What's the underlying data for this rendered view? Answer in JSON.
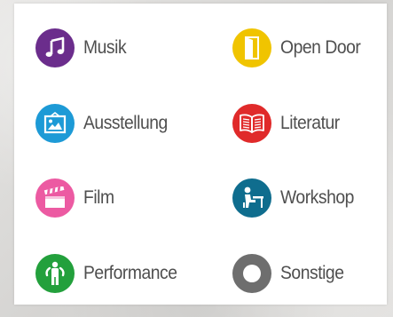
{
  "categories": [
    {
      "label": "Musik",
      "icon": "music-note-icon",
      "color": "#6b2d8c"
    },
    {
      "label": "Open Door",
      "icon": "door-icon",
      "color": "#f0c400"
    },
    {
      "label": "Ausstellung",
      "icon": "framed-picture-icon",
      "color": "#1d9ad6"
    },
    {
      "label": "Literatur",
      "icon": "open-book-icon",
      "color": "#e02a2a"
    },
    {
      "label": "Film",
      "icon": "clapperboard-icon",
      "color": "#ec5aa2"
    },
    {
      "label": "Workshop",
      "icon": "person-at-desk-icon",
      "color": "#0f6d8e"
    },
    {
      "label": "Performance",
      "icon": "performer-icon",
      "color": "#23a03c"
    },
    {
      "label": "Sonstige",
      "icon": "ring-icon",
      "color": "#6e6e6e"
    }
  ]
}
